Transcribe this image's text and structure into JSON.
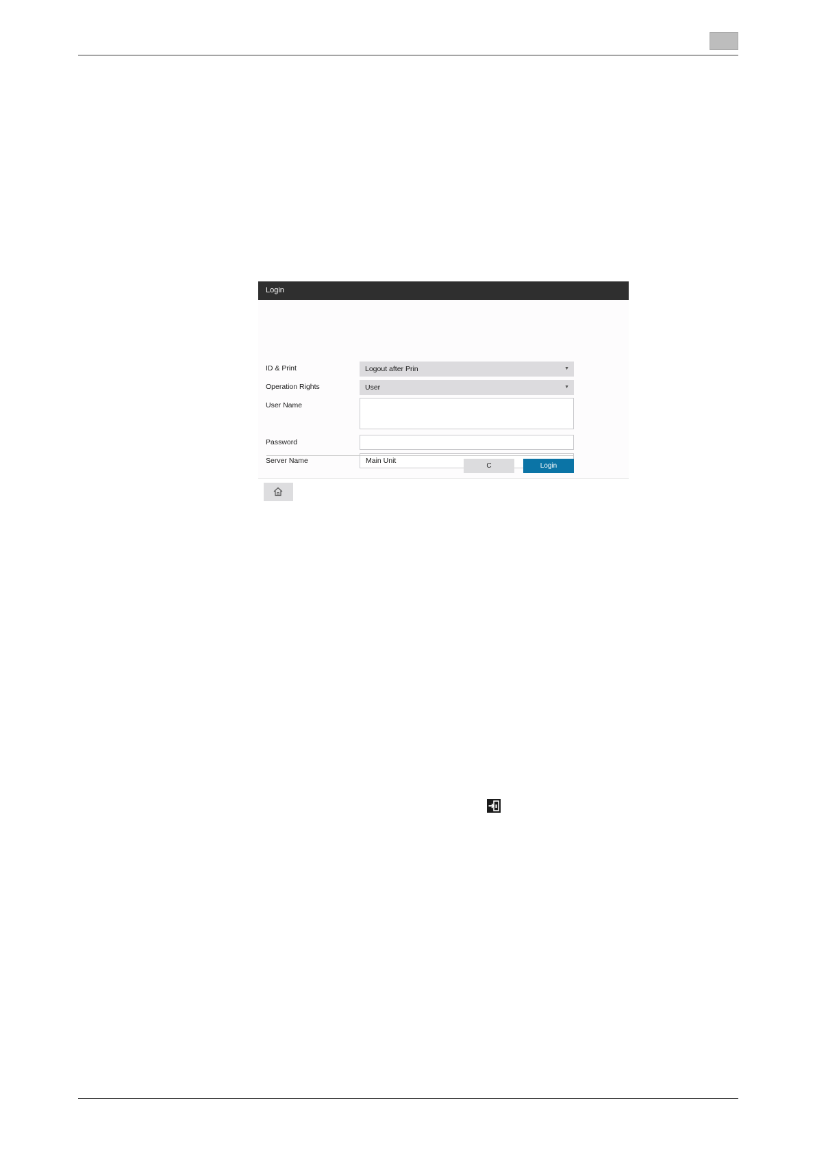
{
  "screen": {
    "title": "Login",
    "fields": [
      {
        "label": "ID & Print",
        "value": "Logout after Prin"
      },
      {
        "label": "Operation Rights",
        "value": "User"
      },
      {
        "label": "User Name",
        "value": ""
      },
      {
        "label": "Password",
        "value": ""
      },
      {
        "label": "Server Name",
        "value": "Main Unit"
      }
    ],
    "buttons": {
      "clear": "C",
      "login": "Login"
    },
    "icons": {
      "dropdown": "caret-down-icon",
      "home": "home-icon",
      "access": "access-login-icon"
    },
    "colors": {
      "title_bar": "#2f2f2f",
      "login_button": "#0b74a6",
      "select_bg": "#dcdbde"
    }
  }
}
